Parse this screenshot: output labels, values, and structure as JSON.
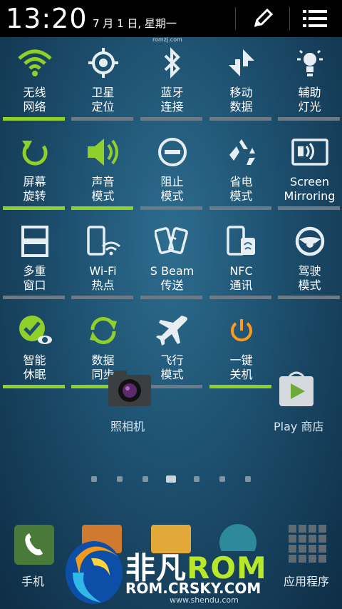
{
  "status_bar": {
    "time": "13:20",
    "date": "7 月 1 日, 星期一",
    "edit_icon": "pencil-icon",
    "settings_icon": "list-settings-icon"
  },
  "watermark_top": "romzj.com",
  "quick_toggles": [
    {
      "label1": "无线",
      "label2": "网络",
      "icon": "wifi-icon",
      "on": true
    },
    {
      "label1": "卫星",
      "label2": "定位",
      "icon": "gps-icon",
      "on": false
    },
    {
      "label1": "蓝牙",
      "label2": "连接",
      "icon": "bluetooth-icon",
      "on": false
    },
    {
      "label1": "移动",
      "label2": "数据",
      "icon": "mobile-data-icon",
      "on": false
    },
    {
      "label1": "辅助",
      "label2": "灯光",
      "icon": "flashlight-icon",
      "on": false
    },
    {
      "label1": "屏幕",
      "label2": "旋转",
      "icon": "rotate-icon",
      "on": true
    },
    {
      "label1": "声音",
      "label2": "模式",
      "icon": "sound-icon",
      "on": true
    },
    {
      "label1": "阻止",
      "label2": "模式",
      "icon": "block-icon",
      "on": false
    },
    {
      "label1": "省电",
      "label2": "模式",
      "icon": "recycle-icon",
      "on": false
    },
    {
      "label1": "Screen",
      "label2": "Mirroring",
      "icon": "screen-mirroring-icon",
      "on": false
    },
    {
      "label1": "多重",
      "label2": "窗口",
      "icon": "multi-window-icon",
      "on": false
    },
    {
      "label1": "Wi-Fi",
      "label2": "热点",
      "icon": "hotspot-icon",
      "on": false
    },
    {
      "label1": "S Beam",
      "label2": "传送",
      "icon": "sbeam-icon",
      "on": false
    },
    {
      "label1": "NFC",
      "label2": "通讯",
      "icon": "nfc-icon",
      "on": false
    },
    {
      "label1": "驾驶",
      "label2": "模式",
      "icon": "steering-wheel-icon",
      "on": false
    },
    {
      "label1": "智能",
      "label2": "休眠",
      "icon": "smart-stay-icon",
      "on": true
    },
    {
      "label1": "数据",
      "label2": "同步",
      "icon": "sync-icon",
      "on": true
    },
    {
      "label1": "飞行",
      "label2": "模式",
      "icon": "airplane-icon",
      "on": false
    },
    {
      "label1": "一键",
      "label2": "关机",
      "icon": "power-icon",
      "on": true
    }
  ],
  "home": {
    "camera_label": "照相机",
    "play_label": "Play 商店",
    "page_count": 7,
    "current_page": 4
  },
  "dock": {
    "phone_label": "手机",
    "apps_label": "应用程序"
  },
  "branding": {
    "title_a": "非凡",
    "title_b": "ROM",
    "url": "ROM.CRSKY.COM",
    "sub": "www.shendu.com"
  },
  "colors": {
    "accent_on": "#8fd12a",
    "bar_off": "#6a7a86",
    "power": "#ff9a1a"
  }
}
